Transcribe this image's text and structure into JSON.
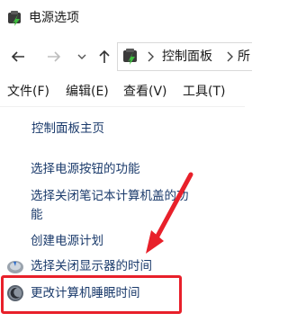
{
  "window": {
    "title": "电源选项",
    "title_icon": "power-options-icon"
  },
  "nav": {
    "back_icon": "arrow-left-icon",
    "forward_icon": "arrow-right-icon",
    "history_icon": "chevron-down-icon",
    "up_icon": "arrow-up-icon",
    "address_icon": "control-panel-icon",
    "breadcrumb": [
      "控制面板",
      "所"
    ]
  },
  "menubar": {
    "file": "文件(F)",
    "edit": "编辑(E)",
    "view": "查看(V)",
    "tools": "工具(T)"
  },
  "sidebar": {
    "home": "控制面板主页",
    "power_buttons": "选择电源按钮的功能",
    "lid_line1": "选择关闭笔记本计算机盖的功",
    "lid_line2": "能",
    "create_plan": "创建电源计划",
    "display_off": "选择关闭显示器的时间",
    "sleep": "更改计算机睡眠时间"
  },
  "annotation": {
    "color": "#e8202a",
    "highlight": "sleep-link",
    "arrow_icon": "red-arrow-icon"
  }
}
